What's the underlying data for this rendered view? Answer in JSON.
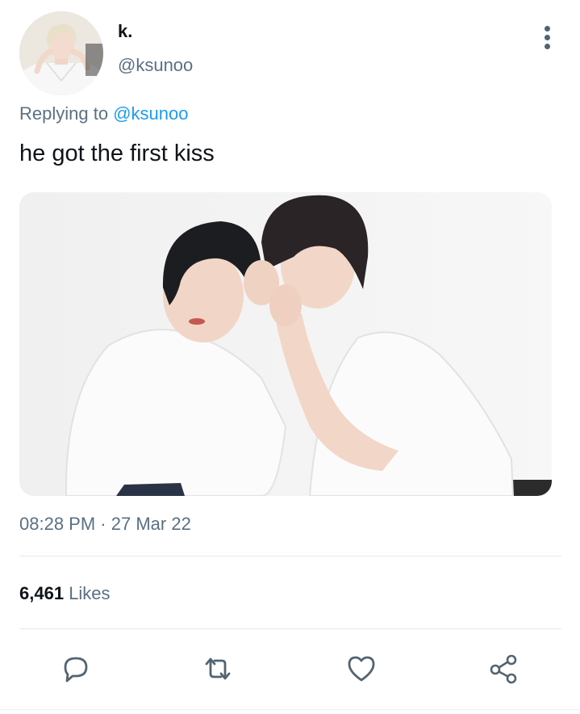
{
  "author": {
    "display_name": "k.",
    "handle": "@ksunoo",
    "avatar_icon": "profile-photo"
  },
  "reply": {
    "prefix": "Replying to",
    "to_handle": "@ksunoo"
  },
  "tweet": {
    "text": "he got the first kiss",
    "media_icon": "photo-two-people-whispering"
  },
  "meta": {
    "time": "08:28 PM",
    "separator": "·",
    "date": "27 Mar 22"
  },
  "stats": {
    "likes_count": "6,461",
    "likes_label": "Likes"
  },
  "actions": [
    {
      "name": "reply",
      "icon": "speech-bubble-icon"
    },
    {
      "name": "retweet",
      "icon": "retweet-icon"
    },
    {
      "name": "like",
      "icon": "heart-icon"
    },
    {
      "name": "share",
      "icon": "share-icon"
    }
  ],
  "colors": {
    "link": "#1d9bf0",
    "secondary_text": "#5b7083",
    "primary_text": "#0f1419",
    "icon": "#536471"
  }
}
